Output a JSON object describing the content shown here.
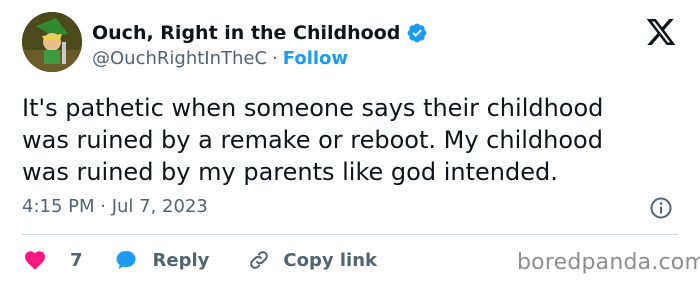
{
  "author": {
    "display_name": "Ouch, Right in the Childhood",
    "handle": "@OuchRightInTheC",
    "separator": "·",
    "follow_label": "Follow",
    "verified": true
  },
  "tweet": {
    "lines": [
      "It's pathetic when someone says their childhood",
      "was ruined by a remake or reboot. My childhood",
      "was ruined by my parents like god intended."
    ],
    "timestamp": "4:15 PM · Jul 7, 2023"
  },
  "actions": {
    "like_count": "7",
    "reply_label": "Reply",
    "copy_link_label": "Copy link"
  },
  "watermark": "boredpanda.com",
  "icons": {
    "verified": "verified-badge-icon",
    "x_logo": "x-logo-icon",
    "info": "info-icon",
    "like": "heart-icon",
    "reply": "speech-bubble-icon",
    "copy": "link-icon"
  },
  "colors": {
    "text": "#0f1419",
    "secondary": "#536471",
    "accent": "#1d9bf0",
    "like": "#f91880",
    "divider": "#cfd9de"
  }
}
